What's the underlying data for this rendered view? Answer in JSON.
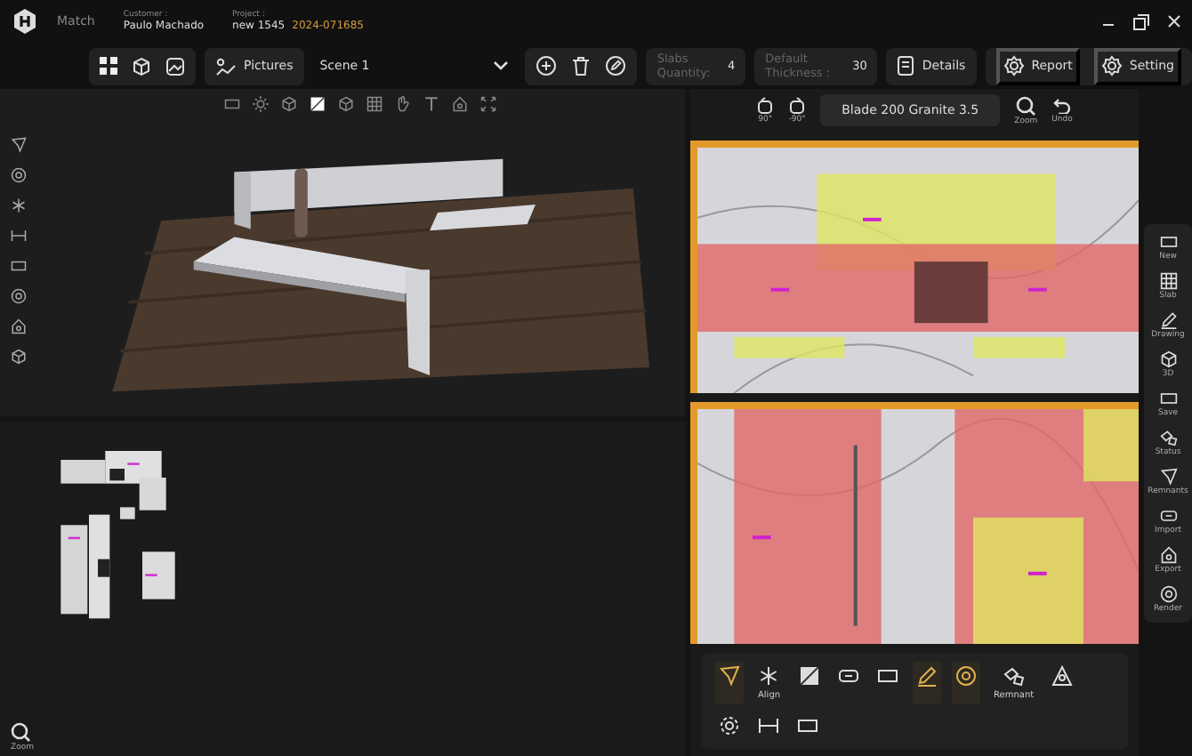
{
  "header": {
    "app": "Match",
    "customer_label": "Customer :",
    "customer": "Paulo Machado",
    "project_label": "Project :",
    "project": "new 1545",
    "project_code": "2024-071685"
  },
  "toolbar": {
    "pictures": "Pictures",
    "scene": "Scene 1",
    "slabs_label": "Slabs Quantity:",
    "slabs_value": "4",
    "thickness_label": "Default Thickness :",
    "thickness_value": "30",
    "details": "Details",
    "report": "Report",
    "setting": "Setting"
  },
  "view_tools": [
    {
      "kind": "frame",
      "selected": false
    },
    {
      "kind": "sun",
      "selected": false
    },
    {
      "kind": "cube",
      "selected": false
    },
    {
      "kind": "square",
      "selected": true
    },
    {
      "kind": "cube",
      "selected": false
    },
    {
      "kind": "grid",
      "selected": false
    },
    {
      "kind": "hand",
      "selected": false
    },
    {
      "kind": "text",
      "selected": false
    },
    {
      "kind": "house",
      "selected": false
    },
    {
      "kind": "expand",
      "selected": false
    }
  ],
  "slab_panel": {
    "rotate_right": "90°",
    "rotate_left": "-90°",
    "blade": "Blade 200 Granite 3.5",
    "zoom": "Zoom",
    "undo": "Undo"
  },
  "side_tools": [
    "New",
    "Slab",
    "Drawing",
    "3D",
    "Save",
    "Status",
    "Remnants",
    "Import",
    "Export",
    "Render"
  ],
  "bottom_tools": [
    {
      "kind": "pointer",
      "highlighted": true
    },
    {
      "kind": "star",
      "label": "Align",
      "highlighted": false
    },
    {
      "kind": "square",
      "highlighted": false
    },
    {
      "kind": "joint",
      "highlighted": false
    },
    {
      "kind": "frame",
      "highlighted": false
    },
    {
      "kind": "pencil",
      "highlighted": true
    },
    {
      "kind": "circle",
      "highlighted": true
    },
    {
      "kind": "shape",
      "label": "Remnant",
      "highlighted": false
    },
    {
      "kind": "triangle",
      "highlighted": false
    },
    {
      "kind": "gear",
      "highlighted": false
    },
    {
      "kind": "measure",
      "highlighted": false
    },
    {
      "kind": "frame",
      "highlighted": false
    }
  ],
  "zoom_label": "Zoom"
}
